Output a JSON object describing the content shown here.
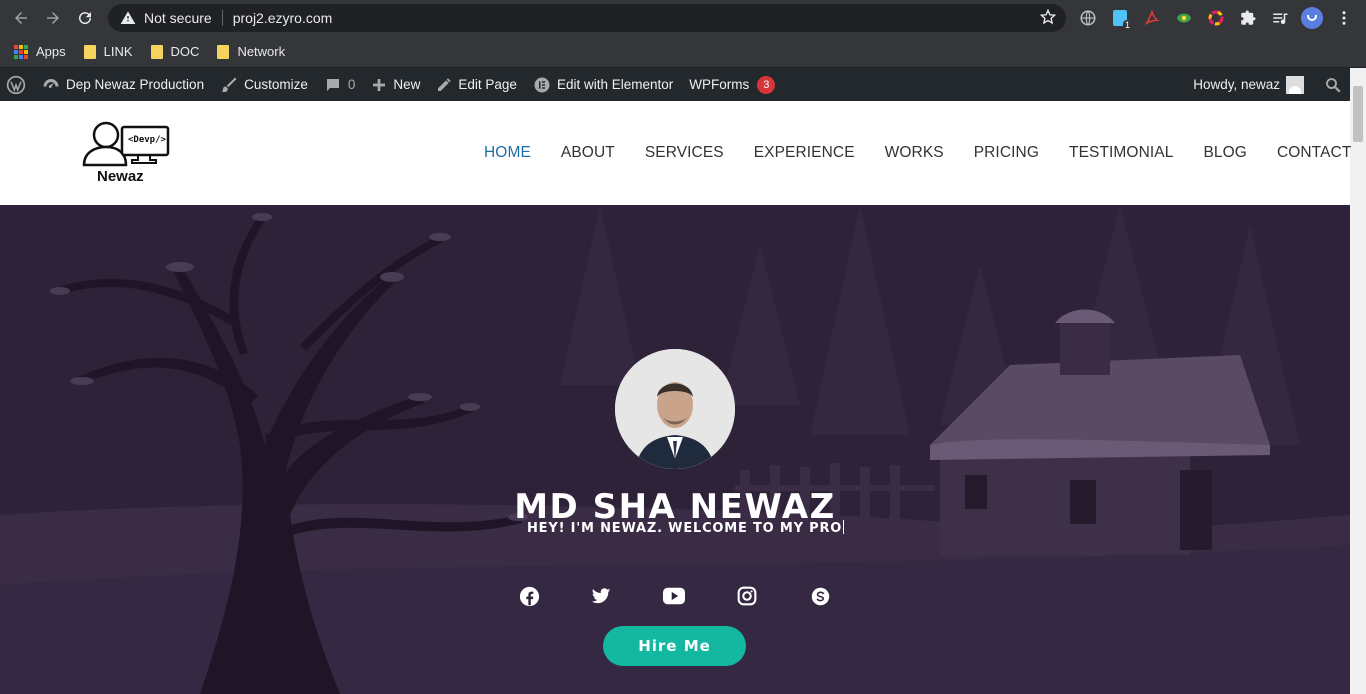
{
  "browser": {
    "security_label": "Not secure",
    "url": "proj2.ezyro.com",
    "extension_badge": "1"
  },
  "bookmarks": [
    {
      "label": "Apps"
    },
    {
      "label": "LINK"
    },
    {
      "label": "DOC"
    },
    {
      "label": "Network"
    }
  ],
  "admin_bar": {
    "site_name": "Dep Newaz Production",
    "customize": "Customize",
    "comments_count": "0",
    "new": "New",
    "edit_page": "Edit Page",
    "edit_elementor": "Edit with Elementor",
    "wpforms": "WPForms",
    "wpforms_count": "3",
    "howdy": "Howdy, newaz"
  },
  "site": {
    "logo_tag": "<Devp/>",
    "logo_name": "Newaz",
    "menu": [
      "HOME",
      "ABOUT",
      "SERVICES",
      "EXPERIENCE",
      "WORKS",
      "PRICING",
      "TESTIMONIAL",
      "BLOG",
      "CONTACT"
    ],
    "active_menu": "HOME"
  },
  "hero": {
    "name": "MD SHA NEWAZ",
    "subtitle": "HEY! I'M NEWAZ. WELCOME TO MY PRO",
    "hire_label": "Hire Me",
    "socials": [
      "facebook-icon",
      "twitter-icon",
      "youtube-icon",
      "instagram-icon",
      "skype-icon"
    ]
  },
  "colors": {
    "accent": "#14b8a0",
    "menu_active": "#1e6ea7",
    "hero_bg": "#2e2238",
    "admin_bar": "#23282d"
  }
}
